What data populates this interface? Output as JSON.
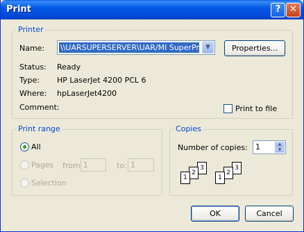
{
  "window": {
    "title": "Print"
  },
  "titlebar": {
    "help_label": "?",
    "close_label": "✕"
  },
  "printer": {
    "legend": "Printer",
    "name_label": "Name:",
    "name_value": "\\\\UARSUPERSERVER\\UAR/MI SuperPrinter",
    "properties_label": "Properties...",
    "status_label": "Status:",
    "status_value": "Ready",
    "type_label": "Type:",
    "type_value": "HP LaserJet 4200 PCL 6",
    "where_label": "Where:",
    "where_value": "hpLaserJet4200",
    "comment_label": "Comment:",
    "print_to_file_label": "Print to file",
    "print_to_file_checked": false
  },
  "print_range": {
    "legend": "Print range",
    "all_label": "All",
    "pages_label": "Pages",
    "from_label": "from:",
    "from_value": "1",
    "to_label": "to:",
    "to_value": "1",
    "selection_label": "Selection",
    "selected": "All"
  },
  "copies": {
    "legend": "Copies",
    "number_label": "Number of copies:",
    "number_value": "1",
    "collate_page_labels": [
      "1",
      "2",
      "3"
    ]
  },
  "footer": {
    "ok_label": "OK",
    "cancel_label": "Cancel"
  },
  "colors": {
    "title_bar": "#0458e8",
    "legend_text": "#0046d5",
    "dialog_bg": "#ece9d8",
    "selection": "#316ac5"
  }
}
